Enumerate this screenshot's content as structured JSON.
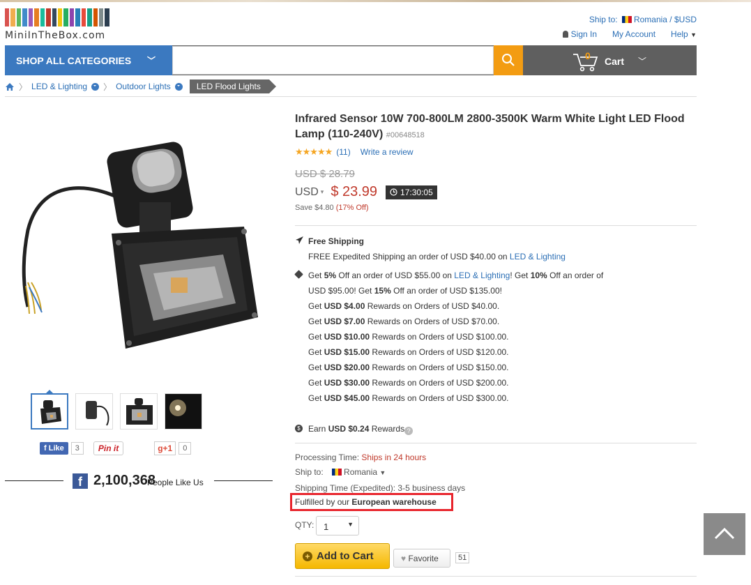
{
  "header": {
    "logo_text": "MiniInTheBox.com",
    "logo_colors": [
      "#d9534f",
      "#f0ad4e",
      "#5cb85c",
      "#428bca",
      "#9b59b6",
      "#e67e22",
      "#1abc9c",
      "#c0392b",
      "#34495e",
      "#f1c40f",
      "#27ae60",
      "#8e44ad",
      "#2980b9",
      "#e74c3c",
      "#16a085",
      "#d35400",
      "#7f8c8d",
      "#2c3e50"
    ],
    "ship_to_label": "Ship to:",
    "ship_to_value": "Romania / $USD",
    "sign_in": "Sign In",
    "my_account": "My Account",
    "help": "Help"
  },
  "nav": {
    "shop_all": "SHOP ALL CATEGORIES",
    "search_placeholder": "",
    "cart_count": "0",
    "cart_label": "Cart"
  },
  "breadcrumb": {
    "items": [
      "LED & Lighting",
      "Outdoor Lights"
    ],
    "current": "LED Flood Lights"
  },
  "product": {
    "title": "Infrared Sensor 10W 700-800LM 2800-3500K Warm White Light LED Flood Lamp (110-240V)",
    "sku": "#00648518",
    "review_count": "(11)",
    "write_review": "Write a review",
    "old_price": "USD $ 28.79",
    "currency": "USD",
    "price": "$ 23.99",
    "timer": "17:30:05",
    "save_text": "Save $4.80",
    "save_pct": "(17% Off)"
  },
  "social": {
    "fb_like": "Like",
    "fb_like_count": "3",
    "pin_label": "Pin it",
    "gplus_label": "g+1",
    "gplus_count": "0",
    "fans_count": "2,100,368",
    "fans_text": "People Like Us"
  },
  "shipping": {
    "free_title": "Free Shipping",
    "free_prefix": "FREE",
    "free_method": "Expedited Shipping",
    "free_mid": "an order of USD $40.00 on",
    "free_cat": "LED & Lighting"
  },
  "promo": {
    "l1_a": "Get",
    "l1_b": "5%",
    "l1_c": "Off an order of USD $55.00 on",
    "l1_link": "LED & Lighting",
    "l1_d": "! Get",
    "l1_e": "10%",
    "l1_f": "Off an order of",
    "l2_a": "USD $95.00! Get",
    "l2_b": "15%",
    "l2_c": "Off an order of USD $135.00!",
    "rewards": [
      {
        "amount": "USD $4.00",
        "order": "Rewards on Orders of USD $40.00."
      },
      {
        "amount": "USD $7.00",
        "order": "Rewards on Orders of USD $70.00."
      },
      {
        "amount": "USD $10.00",
        "order": "Rewards on Orders of USD $100.00."
      },
      {
        "amount": "USD $15.00",
        "order": "Rewards on Orders of USD $120.00."
      },
      {
        "amount": "USD $20.00",
        "order": "Rewards on Orders of USD $150.00."
      },
      {
        "amount": "USD $30.00",
        "order": "Rewards on Orders of USD $200.00."
      },
      {
        "amount": "USD $45.00",
        "order": "Rewards on Orders of USD $300.00."
      }
    ],
    "get": "Get",
    "earn_prefix": "Earn",
    "earn_amount": "USD $0.24",
    "earn_suffix": "Rewards"
  },
  "details": {
    "processing_label": "Processing Time:",
    "processing_value": "Ships in 24 hours",
    "ship_to_label": "Ship to:",
    "ship_to_value": "Romania",
    "shipping_time_label": "Shipping Time (Expedited):",
    "shipping_time_value": "3-5 business days",
    "fulfilled_prefix": "Fulfilled by our",
    "fulfilled_value": "European warehouse",
    "qty_label": "QTY:",
    "qty_value": "1",
    "add_to_cart": "Add to Cart",
    "favorite": "Favorite",
    "favorite_count": "51"
  }
}
